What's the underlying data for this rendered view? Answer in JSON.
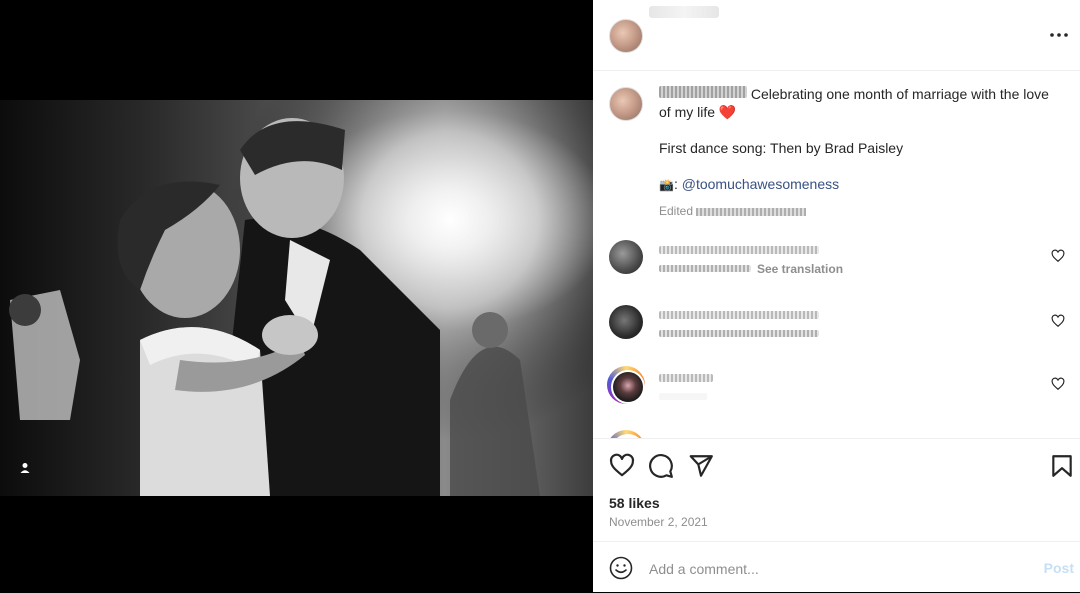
{
  "post": {
    "photo_alt": "",
    "caption": {
      "text": "Celebrating one month of marriage with the love of my life",
      "line2": "First dance song: Then by Brad Paisley",
      "camera_emoji": "📸",
      "mention": "@toomuchawesomeness",
      "edited_label": "Edited"
    },
    "comments": [
      {
        "see_translation": "See translation"
      },
      {},
      {}
    ],
    "likes_text": "58 likes",
    "date_text": "November 2, 2021",
    "add_comment_placeholder": "Add a comment...",
    "post_button_label": "Post"
  },
  "icons": {
    "more": "more-options-icon",
    "like": "heart-icon",
    "comment": "comment-icon",
    "share": "share-icon",
    "save": "bookmark-icon",
    "emoji": "emoji-icon",
    "tag": "user-tag-icon"
  },
  "colors": {
    "heart": "#ed4956",
    "mention": "#385185",
    "muted": "#8e8e8e",
    "post_disabled": "#c7dff5"
  }
}
